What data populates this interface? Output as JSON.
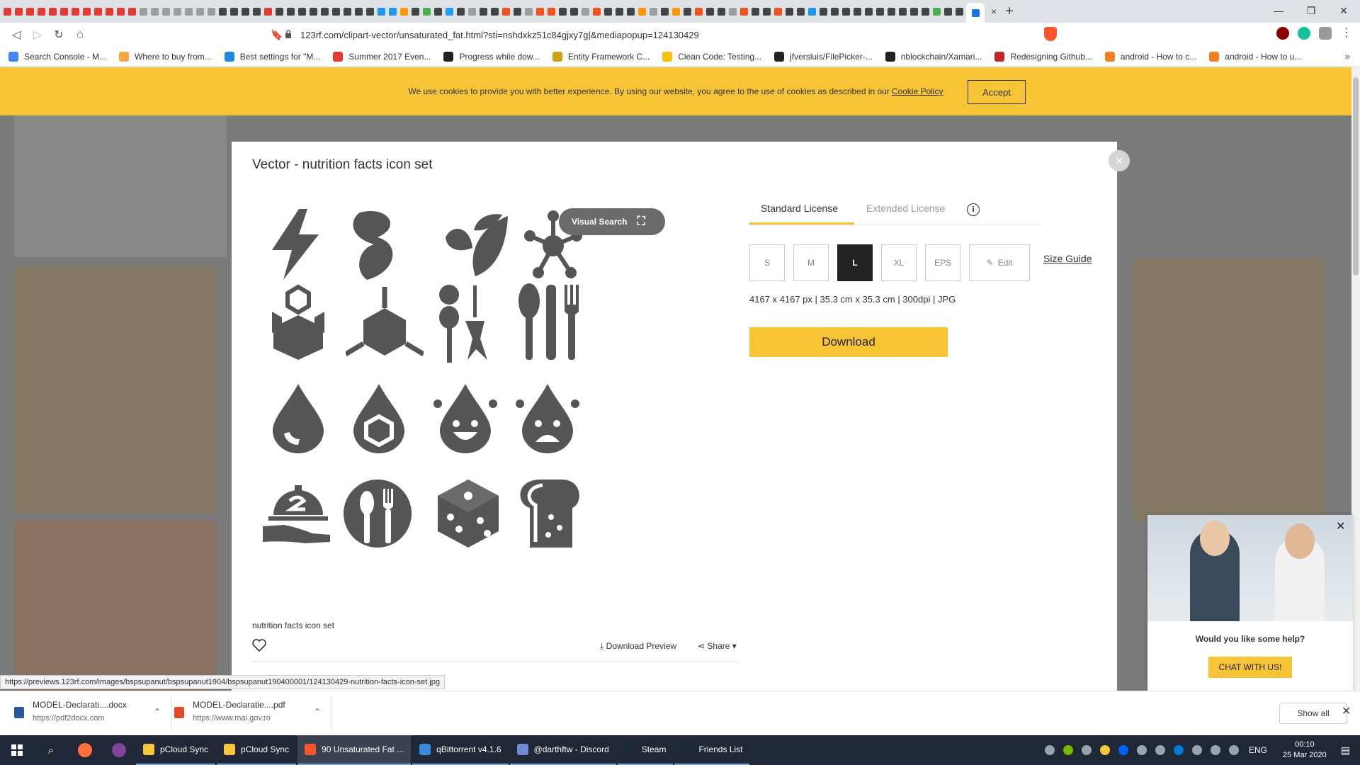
{
  "browser": {
    "active_tab_close": "×",
    "new_tab": "+",
    "url": "123rf.com/clipart-vector/unsaturated_fat.html?sti=nshdxkz51c84gjxy7g|&mediapopup=124130429",
    "bookmarks": [
      {
        "label": "Search Console - M...",
        "color": "#4285f4"
      },
      {
        "label": "Where to buy from...",
        "color": "#f4a742"
      },
      {
        "label": "Best settings for \"M...",
        "color": "#1e88e5"
      },
      {
        "label": "Summer 2017 Even...",
        "color": "#e53935"
      },
      {
        "label": "Progress while dow...",
        "color": "#222222"
      },
      {
        "label": "Entity Framework C...",
        "color": "#d4a017"
      },
      {
        "label": "Clean Code: Testing...",
        "color": "#f4c20d"
      },
      {
        "label": "jfversluis/FilePicker-...",
        "color": "#222222"
      },
      {
        "label": "nblockchain/Xamari...",
        "color": "#222222"
      },
      {
        "label": "Redesigning Github...",
        "color": "#c62828"
      },
      {
        "label": "android - How to c...",
        "color": "#f48024"
      },
      {
        "label": "android - How to u...",
        "color": "#f48024"
      }
    ],
    "bookmarks_more": "»",
    "status_url": "https://previews.123rf.com/images/bspsupanut/bspsupanut1904/bspsupanut190400001/124130429-nutrition-facts-icon-set.jpg"
  },
  "cookie": {
    "message": "We use cookies to provide you with better experience. By using our website, you agree to the use of cookies as described in our",
    "policy_link": "Cookie Policy",
    "accept": "Accept"
  },
  "modal": {
    "title": "Vector - nutrition facts icon set",
    "close": "×",
    "visual_search": "Visual Search",
    "caption": "nutrition facts icon set",
    "download_preview": "Download Preview",
    "share": "Share ▾",
    "licenses": {
      "standard": "Standard License",
      "extended": "Extended License"
    },
    "sizes": [
      "S",
      "M",
      "L",
      "XL",
      "EPS"
    ],
    "selected_size": "L",
    "edit": "Edit",
    "size_guide": "Size Guide",
    "dims": "4167 x 4167 px | 35.3 cm x 35.3 cm | 300dpi | JPG",
    "download": "Download"
  },
  "chat": {
    "question": "Would you like some help?",
    "button": "CHAT WITH US!",
    "close": "✕"
  },
  "downloads": {
    "items": [
      {
        "file": "MODEL-Declarati....docx",
        "source": "https://pdf2docx.com",
        "color": "#2b579a"
      },
      {
        "file": "MODEL-Declaratie....pdf",
        "source": "https://www.mai.gov.ro",
        "color": "#e04a2f"
      }
    ],
    "show_all": "Show all"
  },
  "taskbar": {
    "apps": [
      {
        "label": "pCloud Sync",
        "color": "#f6c63f",
        "active": false
      },
      {
        "label": "pCloud Sync",
        "color": "#f6c63f",
        "active": false
      },
      {
        "label": "90 Unsaturated Fat ...",
        "color": "#fb542b",
        "active": true
      },
      {
        "label": "qBittorrent v4.1.6",
        "color": "#3b8cde",
        "active": false
      },
      {
        "label": "@darthftw - Discord",
        "color": "#7289da",
        "active": false
      },
      {
        "label": "Steam",
        "color": "#1b2838",
        "active": false
      },
      {
        "label": "Friends List",
        "color": "#1b2838",
        "active": false
      }
    ],
    "lang": "ENG",
    "time": "00:10",
    "date": "25 Mar 2020"
  },
  "colors": {
    "accent": "#f7c435",
    "icon_gray": "#555555"
  }
}
